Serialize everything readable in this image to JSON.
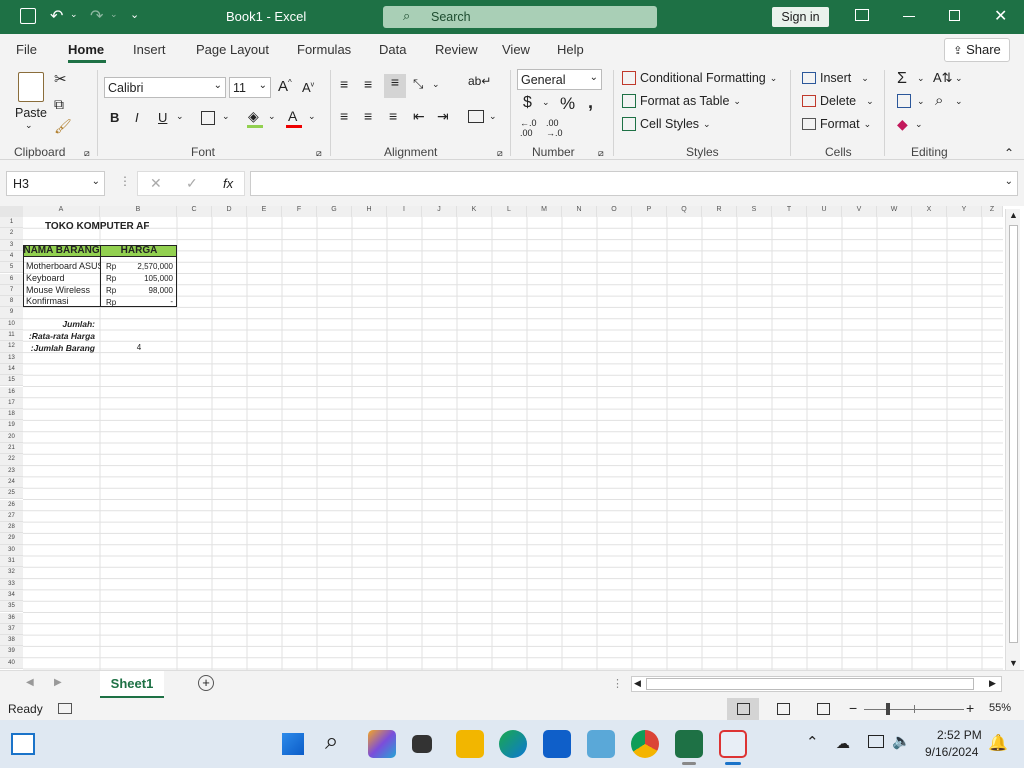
{
  "titlebar": {
    "doc_title": "Book1  -  Excel",
    "search_placeholder": "Search",
    "signin": "Sign in"
  },
  "tabs": [
    "File",
    "Home",
    "Insert",
    "Page Layout",
    "Formulas",
    "Data",
    "Review",
    "View",
    "Help"
  ],
  "share_label": "Share",
  "ribbon": {
    "clipboard": {
      "paste": "Paste",
      "group": "Clipboard"
    },
    "font": {
      "name": "Calibri",
      "size": "11",
      "group": "Font",
      "bold": "B",
      "italic": "I",
      "underline": "U"
    },
    "alignment": {
      "group": "Alignment"
    },
    "number": {
      "format": "General",
      "group": "Number"
    },
    "styles": {
      "cond": "Conditional Formatting",
      "table": "Format as Table",
      "cell": "Cell Styles",
      "group": "Styles"
    },
    "cells": {
      "insert": "Insert",
      "delete": "Delete",
      "format": "Format",
      "group": "Cells"
    },
    "editing": {
      "group": "Editing"
    }
  },
  "formula_bar": {
    "name_box": "H3",
    "fx": "fx",
    "value": ""
  },
  "columns": [
    "A",
    "B",
    "C",
    "D",
    "E",
    "F",
    "G",
    "H",
    "I",
    "J",
    "K",
    "L",
    "M",
    "N",
    "O",
    "P",
    "Q",
    "R",
    "S",
    "T",
    "U",
    "V",
    "W",
    "X",
    "Y",
    "Z"
  ],
  "rows": [
    "1",
    "2",
    "3",
    "4",
    "5",
    "6",
    "7",
    "8",
    "9",
    "10",
    "11",
    "12",
    "13",
    "14",
    "15",
    "16",
    "17",
    "18",
    "19",
    "20",
    "21",
    "22",
    "23",
    "24",
    "25",
    "26",
    "27",
    "28",
    "29",
    "30",
    "31",
    "32",
    "33",
    "34",
    "35",
    "36",
    "37",
    "38",
    "39",
    "40"
  ],
  "sheet": {
    "title": "TOKO KOMPUTER AF",
    "header_a": "NAMA BARANG",
    "header_b": "HARGA",
    "items": [
      {
        "name": "Motherboard ASUS",
        "cur": "Rp",
        "price": "2,570,000"
      },
      {
        "name": "Keyboard",
        "cur": "Rp",
        "price": "105,000"
      },
      {
        "name": "Mouse Wireless",
        "cur": "Rp",
        "price": "98,000"
      },
      {
        "name": "Konfirmasi",
        "cur": "Rp",
        "price": "-"
      }
    ],
    "jumlah": "Jumlah:",
    "ratarata": "Rata-rata Harga:",
    "jumlah_barang": "Jumlah Barang:",
    "jumlah_barang_val": "4"
  },
  "sheet_tab": "Sheet1",
  "status": {
    "ready": "Ready",
    "zoom": "55%"
  },
  "taskbar": {
    "time": "2:52 PM",
    "date": "9/16/2024"
  },
  "colors": {
    "excel_green": "#1e7145",
    "header_fill": "#92d050"
  }
}
